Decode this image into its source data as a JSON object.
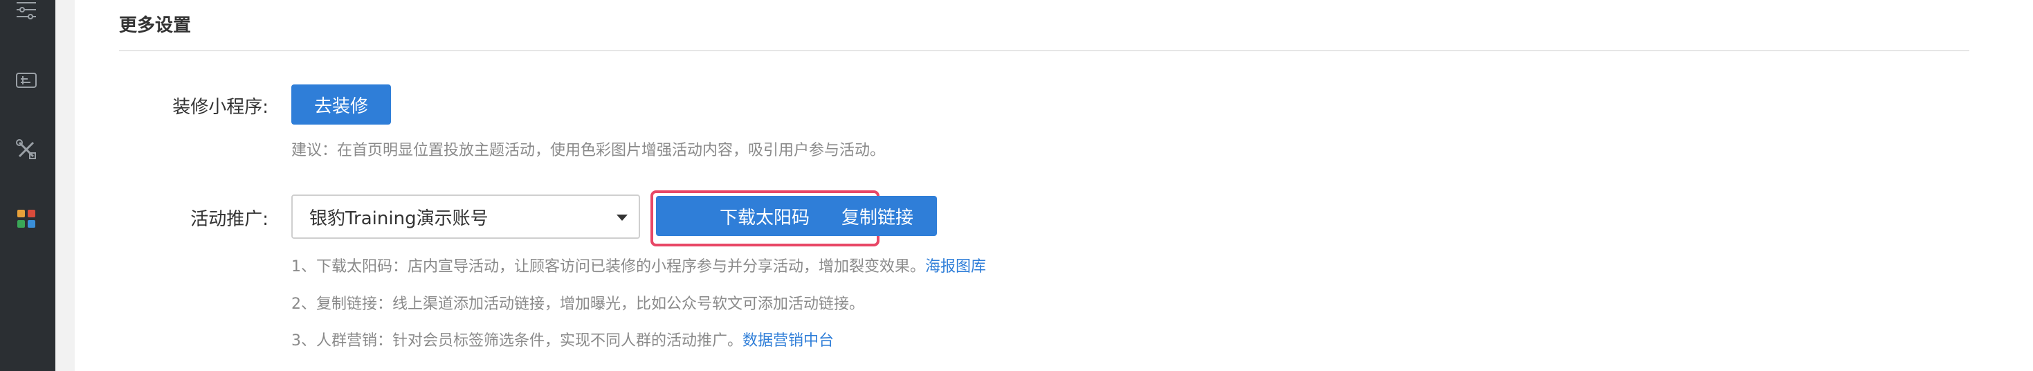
{
  "section": {
    "title": "更多设置"
  },
  "decorate": {
    "label": "装修小程序:",
    "button": "去装修",
    "hint": "建议：在首页明显位置投放主题活动，使用色彩图片增强活动内容，吸引用户参与活动。"
  },
  "promotion": {
    "label": "活动推广:",
    "select_value": "银豹Training演示账号",
    "download_button": "下载太阳码",
    "copy_button": "复制链接",
    "hints": [
      {
        "text": "1、下载太阳码：店内宣导活动，让顾客访问已装修的小程序参与并分享活动，增加裂变效果。",
        "link": "海报图库"
      },
      {
        "text": "2、复制链接：线上渠道添加活动链接，增加曝光，比如公众号软文可添加活动链接。",
        "link": ""
      },
      {
        "text": "3、人群营销：针对会员标签筛选条件，实现不同人群的活动推广。",
        "link": "数据营销中台"
      }
    ]
  },
  "sidebar": {
    "icons": [
      "sliders-icon",
      "card-icon",
      "tools-icon",
      "apps-icon"
    ]
  },
  "colors": {
    "sidebar_bg": "#2b2f33",
    "primary": "#2f7ed8",
    "highlight": "#e84766",
    "hint_text": "#8a8a8a"
  }
}
